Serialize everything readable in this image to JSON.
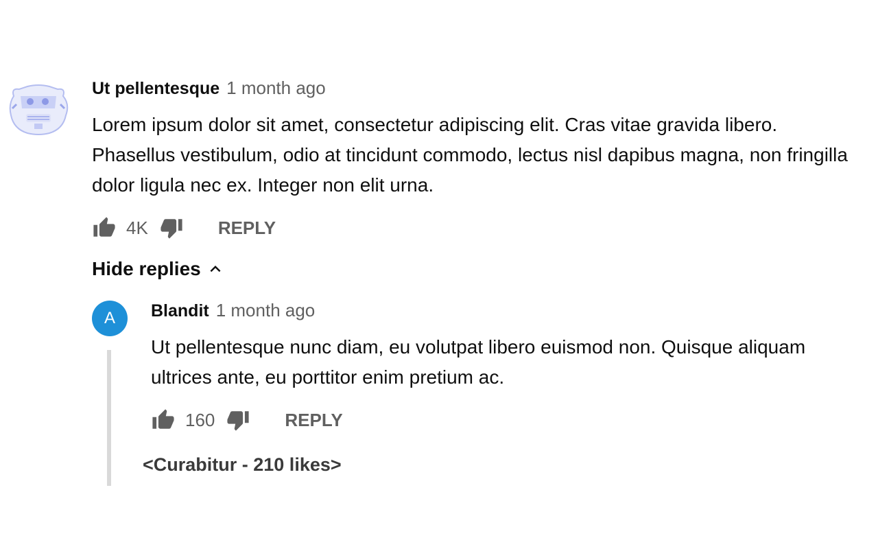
{
  "comment": {
    "author": "Ut pellentesque",
    "time": "1 month ago",
    "text": "Lorem ipsum dolor sit amet, consectetur adipiscing elit. Cras vitae gravida libero. Phasellus vestibulum, odio at tincidunt commodo, lectus nisl dapibus magna, non fringilla dolor ligula nec ex. Integer non elit urna.",
    "likes": "4K",
    "reply_label": "REPLY",
    "avatar_icon": "pixelated-robot-avatar"
  },
  "replies": {
    "toggle_label": "Hide replies",
    "toggle_icon": "chevron-up-icon",
    "items": [
      {
        "avatar_letter": "A",
        "avatar_color": "#1e90d8",
        "author": "Blandit",
        "time": "1 month ago",
        "text": "Ut pellentesque nunc diam, eu volutpat libero euismod non. Quisque aliquam ultrices ante, eu porttitor enim pretium ac.",
        "likes": "160",
        "reply_label": "REPLY"
      }
    ],
    "more_label": "<Curabitur - 210 likes>"
  },
  "colors": {
    "primary_text": "#0f0f0f",
    "secondary_text": "#606060",
    "thread_line": "#d9d9d9"
  }
}
